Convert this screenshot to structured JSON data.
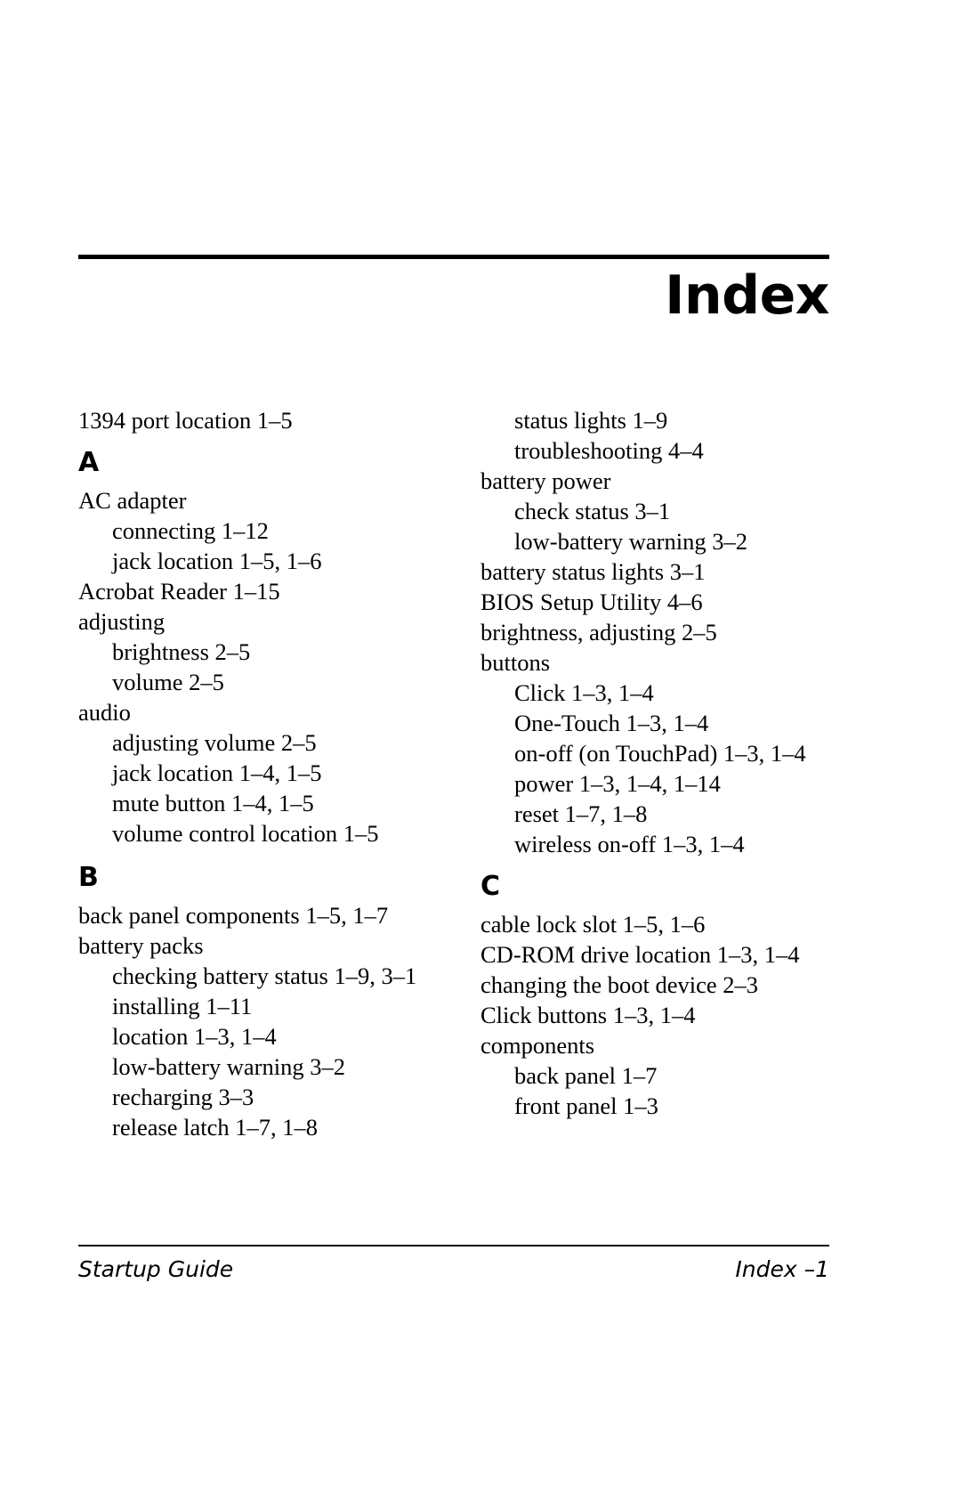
{
  "header": {
    "title": "Index"
  },
  "columns": {
    "left": [
      {
        "kind": "entry",
        "level": 0,
        "wrapped": false,
        "text": "1394 port location 1–5"
      },
      {
        "kind": "letter",
        "text": "A"
      },
      {
        "kind": "entry",
        "level": 0,
        "wrapped": false,
        "text": "AC adapter"
      },
      {
        "kind": "entry",
        "level": 1,
        "wrapped": false,
        "text": "connecting 1–12"
      },
      {
        "kind": "entry",
        "level": 1,
        "wrapped": false,
        "text": "jack location 1–5, 1–6"
      },
      {
        "kind": "entry",
        "level": 0,
        "wrapped": false,
        "text": "Acrobat Reader 1–15"
      },
      {
        "kind": "entry",
        "level": 0,
        "wrapped": false,
        "text": "adjusting"
      },
      {
        "kind": "entry",
        "level": 1,
        "wrapped": false,
        "text": "brightness 2–5"
      },
      {
        "kind": "entry",
        "level": 1,
        "wrapped": false,
        "text": "volume 2–5"
      },
      {
        "kind": "entry",
        "level": 0,
        "wrapped": false,
        "text": "audio"
      },
      {
        "kind": "entry",
        "level": 1,
        "wrapped": false,
        "text": "adjusting volume 2–5"
      },
      {
        "kind": "entry",
        "level": 1,
        "wrapped": false,
        "text": "jack location 1–4, 1–5"
      },
      {
        "kind": "entry",
        "level": 1,
        "wrapped": false,
        "text": "mute button 1–4, 1–5"
      },
      {
        "kind": "entry",
        "level": 1,
        "wrapped": false,
        "text": "volume control location 1–5"
      },
      {
        "kind": "letter",
        "text": "B"
      },
      {
        "kind": "entry",
        "level": 0,
        "wrapped": true,
        "text": "back panel components 1–5, 1–7"
      },
      {
        "kind": "entry",
        "level": 0,
        "wrapped": false,
        "text": "battery packs"
      },
      {
        "kind": "entry",
        "level": 1,
        "wrapped": true,
        "text": "checking battery status 1–9, 3–1"
      },
      {
        "kind": "entry",
        "level": 1,
        "wrapped": false,
        "text": "installing 1–11"
      },
      {
        "kind": "entry",
        "level": 1,
        "wrapped": false,
        "text": "location 1–3, 1–4"
      },
      {
        "kind": "entry",
        "level": 1,
        "wrapped": false,
        "text": "low-battery warning 3–2"
      },
      {
        "kind": "entry",
        "level": 1,
        "wrapped": false,
        "text": "recharging 3–3"
      },
      {
        "kind": "entry",
        "level": 1,
        "wrapped": false,
        "text": "release latch 1–7, 1–8"
      }
    ],
    "right": [
      {
        "kind": "entry",
        "level": 1,
        "wrapped": false,
        "text": "status lights 1–9"
      },
      {
        "kind": "entry",
        "level": 1,
        "wrapped": false,
        "text": "troubleshooting 4–4"
      },
      {
        "kind": "entry",
        "level": 0,
        "wrapped": false,
        "text": "battery power"
      },
      {
        "kind": "entry",
        "level": 1,
        "wrapped": false,
        "text": "check status 3–1"
      },
      {
        "kind": "entry",
        "level": 1,
        "wrapped": false,
        "text": "low-battery warning 3–2"
      },
      {
        "kind": "entry",
        "level": 0,
        "wrapped": false,
        "text": "battery status lights 3–1"
      },
      {
        "kind": "entry",
        "level": 0,
        "wrapped": false,
        "text": "BIOS Setup Utility 4–6"
      },
      {
        "kind": "entry",
        "level": 0,
        "wrapped": false,
        "text": "brightness, adjusting 2–5"
      },
      {
        "kind": "entry",
        "level": 0,
        "wrapped": false,
        "text": "buttons"
      },
      {
        "kind": "entry",
        "level": 1,
        "wrapped": false,
        "text": "Click 1–3, 1–4"
      },
      {
        "kind": "entry",
        "level": 1,
        "wrapped": false,
        "text": "One-Touch 1–3, 1–4"
      },
      {
        "kind": "entry",
        "level": 1,
        "wrapped": true,
        "text": "on-off (on TouchPad) 1–3, 1–4"
      },
      {
        "kind": "entry",
        "level": 1,
        "wrapped": false,
        "text": "power 1–3, 1–4, 1–14"
      },
      {
        "kind": "entry",
        "level": 1,
        "wrapped": false,
        "text": "reset 1–7, 1–8"
      },
      {
        "kind": "entry",
        "level": 1,
        "wrapped": false,
        "text": "wireless on-off 1–3, 1–4"
      },
      {
        "kind": "letter",
        "text": "C"
      },
      {
        "kind": "entry",
        "level": 0,
        "wrapped": false,
        "text": "cable lock slot 1–5, 1–6"
      },
      {
        "kind": "entry",
        "level": 0,
        "wrapped": true,
        "text": "CD-ROM drive location 1–3, 1–4"
      },
      {
        "kind": "entry",
        "level": 0,
        "wrapped": false,
        "text": "changing the boot device 2–3"
      },
      {
        "kind": "entry",
        "level": 0,
        "wrapped": false,
        "text": "Click buttons 1–3, 1–4"
      },
      {
        "kind": "entry",
        "level": 0,
        "wrapped": false,
        "text": "components"
      },
      {
        "kind": "entry",
        "level": 1,
        "wrapped": false,
        "text": "back panel 1–7"
      },
      {
        "kind": "entry",
        "level": 1,
        "wrapped": false,
        "text": "front panel 1–3"
      }
    ]
  },
  "footer": {
    "left": "Startup Guide",
    "right": "Index –1"
  }
}
